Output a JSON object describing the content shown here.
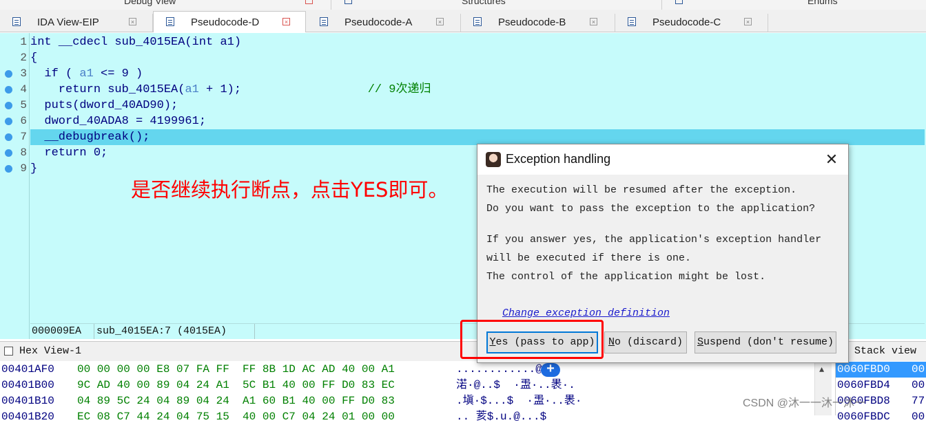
{
  "top_strip": {
    "titles": [
      "Debug View",
      "Structures",
      "Enums"
    ]
  },
  "tabs": [
    {
      "label": "IDA View-EIP",
      "active": false
    },
    {
      "label": "Pseudocode-D",
      "active": true
    },
    {
      "label": "Pseudocode-A",
      "active": false
    },
    {
      "label": "Pseudocode-B",
      "active": false
    },
    {
      "label": "Pseudocode-C",
      "active": false
    }
  ],
  "code": {
    "line_numbers": [
      "1",
      "2",
      "3",
      "4",
      "5",
      "6",
      "7",
      "8",
      "9"
    ],
    "lines": [
      {
        "pre": "int __cdecl sub_4015EA(int a1)",
        "var": "",
        "post": "",
        "comment": "",
        "breakpoint": false
      },
      {
        "pre": "{",
        "var": "",
        "post": "",
        "comment": "",
        "breakpoint": false
      },
      {
        "pre": "  if ( ",
        "var": "a1",
        "post": " <= 9 )",
        "comment": "",
        "breakpoint": true
      },
      {
        "pre": "    return sub_4015EA(",
        "var": "a1",
        "post": " + 1);                  ",
        "comment": "// 9次递归",
        "breakpoint": true
      },
      {
        "pre": "  puts(dword_40AD90);",
        "var": "",
        "post": "",
        "comment": "",
        "breakpoint": true
      },
      {
        "pre": "  dword_40ADA8 = 4199961;",
        "var": "",
        "post": "",
        "comment": "",
        "breakpoint": true
      },
      {
        "pre": "  __debugbreak();",
        "var": "",
        "post": "",
        "comment": "",
        "breakpoint": true
      },
      {
        "pre": "  return 0;",
        "var": "",
        "post": "",
        "comment": "",
        "breakpoint": true
      },
      {
        "pre": "}",
        "var": "",
        "post": "",
        "comment": "",
        "breakpoint": true
      }
    ],
    "highlighted_line": 7,
    "annotation": "是否继续执行断点，点击YES即可。",
    "status_offset": "000009EA",
    "status_location": "sub_4015EA:7 (4015EA)"
  },
  "hex_view": {
    "title": "Hex View-1",
    "rows": [
      {
        "addr": "00401AF0",
        "bytes": "00 00 00 00 E8 07 FA FF  FF 8B 1D AC AD 40 00 A1",
        "ascii": "............@.."
      },
      {
        "addr": "00401B00",
        "bytes": "9C AD 40 00 89 04 24 A1  5C B1 40 00 FF D0 83 EC",
        "ascii": "渃·@..$  ·盄·..褁·."
      },
      {
        "addr": "00401B10",
        "bytes": "04 89 5C 24 04 89 04 24  A1 60 B1 40 00 FF D0 83",
        "ascii": ".塡·$...$  ·盄·..褁·"
      },
      {
        "addr": "00401B20",
        "bytes": "EC 08 C7 44 24 04 75 15  40 00 C7 04 24 01 00 00",
        "ascii": ".. 荄$.u.@...$"
      }
    ]
  },
  "stack_view": {
    "title": "Stack view",
    "rows": [
      {
        "addr": "0060FBD0",
        "val": "00"
      },
      {
        "addr": "0060FBD4",
        "val": "00"
      },
      {
        "addr": "0060FBD8",
        "val": "77"
      },
      {
        "addr": "0060FBDC",
        "val": "00"
      }
    ]
  },
  "dialog": {
    "title": "Exception handling",
    "message_lines_1": [
      "The execution will be resumed after the exception.",
      "Do you want to pass the exception to the application?"
    ],
    "message_lines_2": [
      "If you answer yes, the application's exception handler",
      "will be executed if there is one.",
      "The control of the application might be lost."
    ],
    "link": "Change exception definition",
    "buttons": {
      "yes": {
        "hotkey": "Y",
        "rest": "es (pass to app)"
      },
      "no": {
        "hotkey": "N",
        "rest": "o (discard)"
      },
      "suspend": {
        "hotkey": "S",
        "rest": "uspend (don't resume)"
      }
    }
  },
  "watermark": "CSDN @沐一一沐一沐一"
}
